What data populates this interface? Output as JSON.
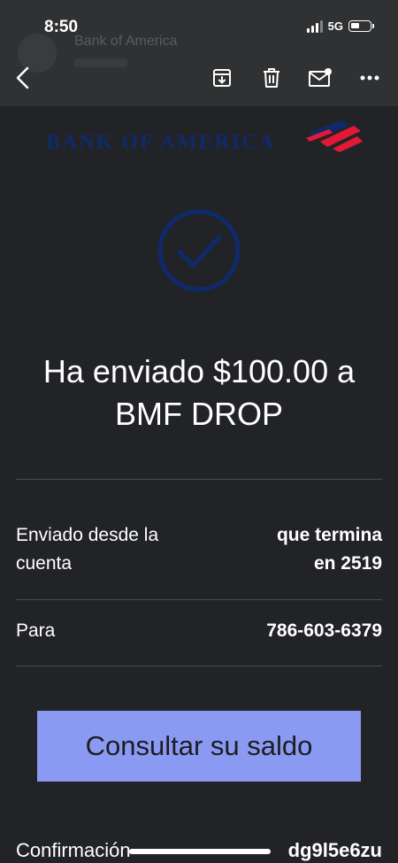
{
  "status_bar": {
    "time": "8:50",
    "network": "5G"
  },
  "header": {
    "sender": "Bank of America"
  },
  "toolbar": {
    "back_icon": "chevron-left-icon",
    "archive_icon": "archive-icon",
    "delete_icon": "trash-icon",
    "mark_unread_icon": "mail-unread-icon",
    "more_icon": "more-horizontal-icon"
  },
  "email": {
    "brand": "BANK OF AMERICA",
    "success_icon": "check-circle-icon",
    "headline_line1": "Ha enviado $100.00 a",
    "headline_line2": "BMF DROP",
    "rows": [
      {
        "label_line1": "Enviado desde la",
        "label_line2": "cuenta",
        "value_line1": "que termina",
        "value_line2": "en 2519"
      },
      {
        "label": "Para",
        "value": "786-603-6379"
      }
    ],
    "cta_label": "Consultar su saldo",
    "confirmation_label": "Confirmación",
    "confirmation_value": "dg9l5e6zu"
  },
  "colors": {
    "background": "#222327",
    "toolbar": "#303133",
    "brand_navy": "#0f2a6b",
    "brand_red": "#e31837",
    "cta": "#8a9af3"
  }
}
